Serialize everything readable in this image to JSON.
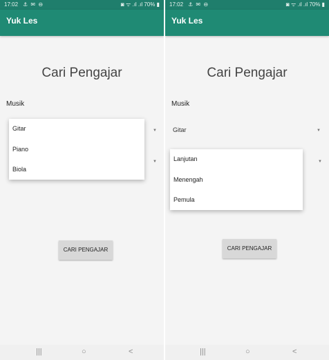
{
  "status_bar": {
    "time": "17:02",
    "left_icons": "⚓ ✉ ⊖",
    "right_icons": "◙ ᯤ .ıl .ıl 70% ▮"
  },
  "app": {
    "title": "Yuk Les"
  },
  "page_title": "Cari Pengajar",
  "category_label": "Musik",
  "instrument_selected": "Gitar",
  "instrument_options": [
    "Gitar",
    "Piano",
    "Biola"
  ],
  "level_options": [
    "Lanjutan",
    "Menengah",
    "Pemula"
  ],
  "search_button_label": "CARI PENGAJAR",
  "nav": {
    "recents": "|||",
    "home": "○",
    "back": "<"
  },
  "colors": {
    "status_bar": "#1f7e6c",
    "app_bar": "#1f8a74",
    "background": "#f4f4f4"
  }
}
